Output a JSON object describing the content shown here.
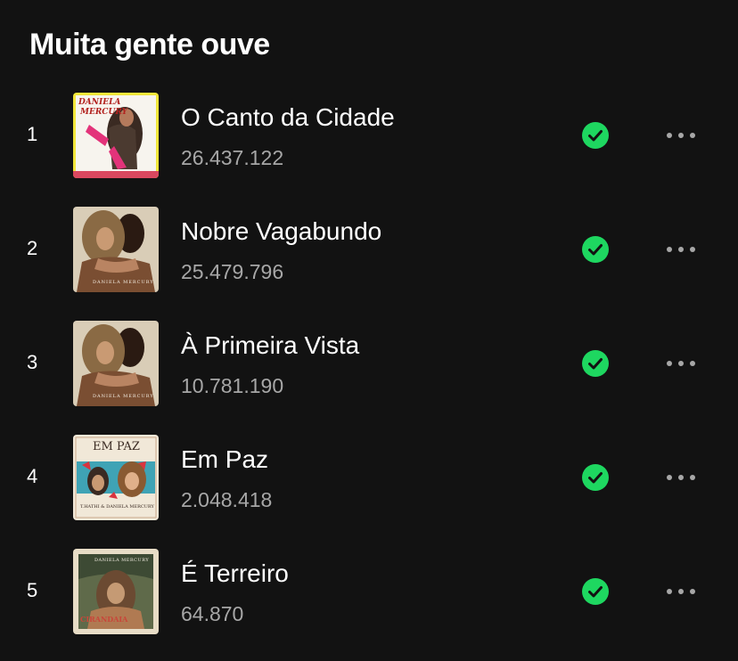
{
  "section": {
    "title": "Muita gente ouve"
  },
  "colors": {
    "background": "#121212",
    "accent_green": "#1ed760",
    "secondary_text": "#a7a7a7"
  },
  "tracks": [
    {
      "rank": "1",
      "title": "O Canto da Cidade",
      "plays": "26.437.122",
      "saved": true,
      "saved_icon": "check-circle-icon",
      "more_icon": "more-options-icon",
      "cover_text": [
        "DANIELA",
        "MERCURY"
      ]
    },
    {
      "rank": "2",
      "title": "Nobre Vagabundo",
      "plays": "25.479.796",
      "saved": true,
      "saved_icon": "check-circle-icon",
      "more_icon": "more-options-icon",
      "cover_text": [
        "DANIELA MERCURY"
      ]
    },
    {
      "rank": "3",
      "title": "À Primeira Vista",
      "plays": "10.781.190",
      "saved": true,
      "saved_icon": "check-circle-icon",
      "more_icon": "more-options-icon",
      "cover_text": [
        "DANIELA MERCURY"
      ]
    },
    {
      "rank": "4",
      "title": "Em Paz",
      "plays": "2.048.418",
      "saved": true,
      "saved_icon": "check-circle-icon",
      "more_icon": "more-options-icon",
      "cover_text": [
        "EM PAZ",
        "T.HATHI & DANIELA MERCURY"
      ]
    },
    {
      "rank": "5",
      "title": "É Terreiro",
      "plays": "64.870",
      "saved": true,
      "saved_icon": "check-circle-icon",
      "more_icon": "more-options-icon",
      "cover_text": [
        "DANIELA MERCURY",
        "CIRANDAIA"
      ]
    }
  ]
}
